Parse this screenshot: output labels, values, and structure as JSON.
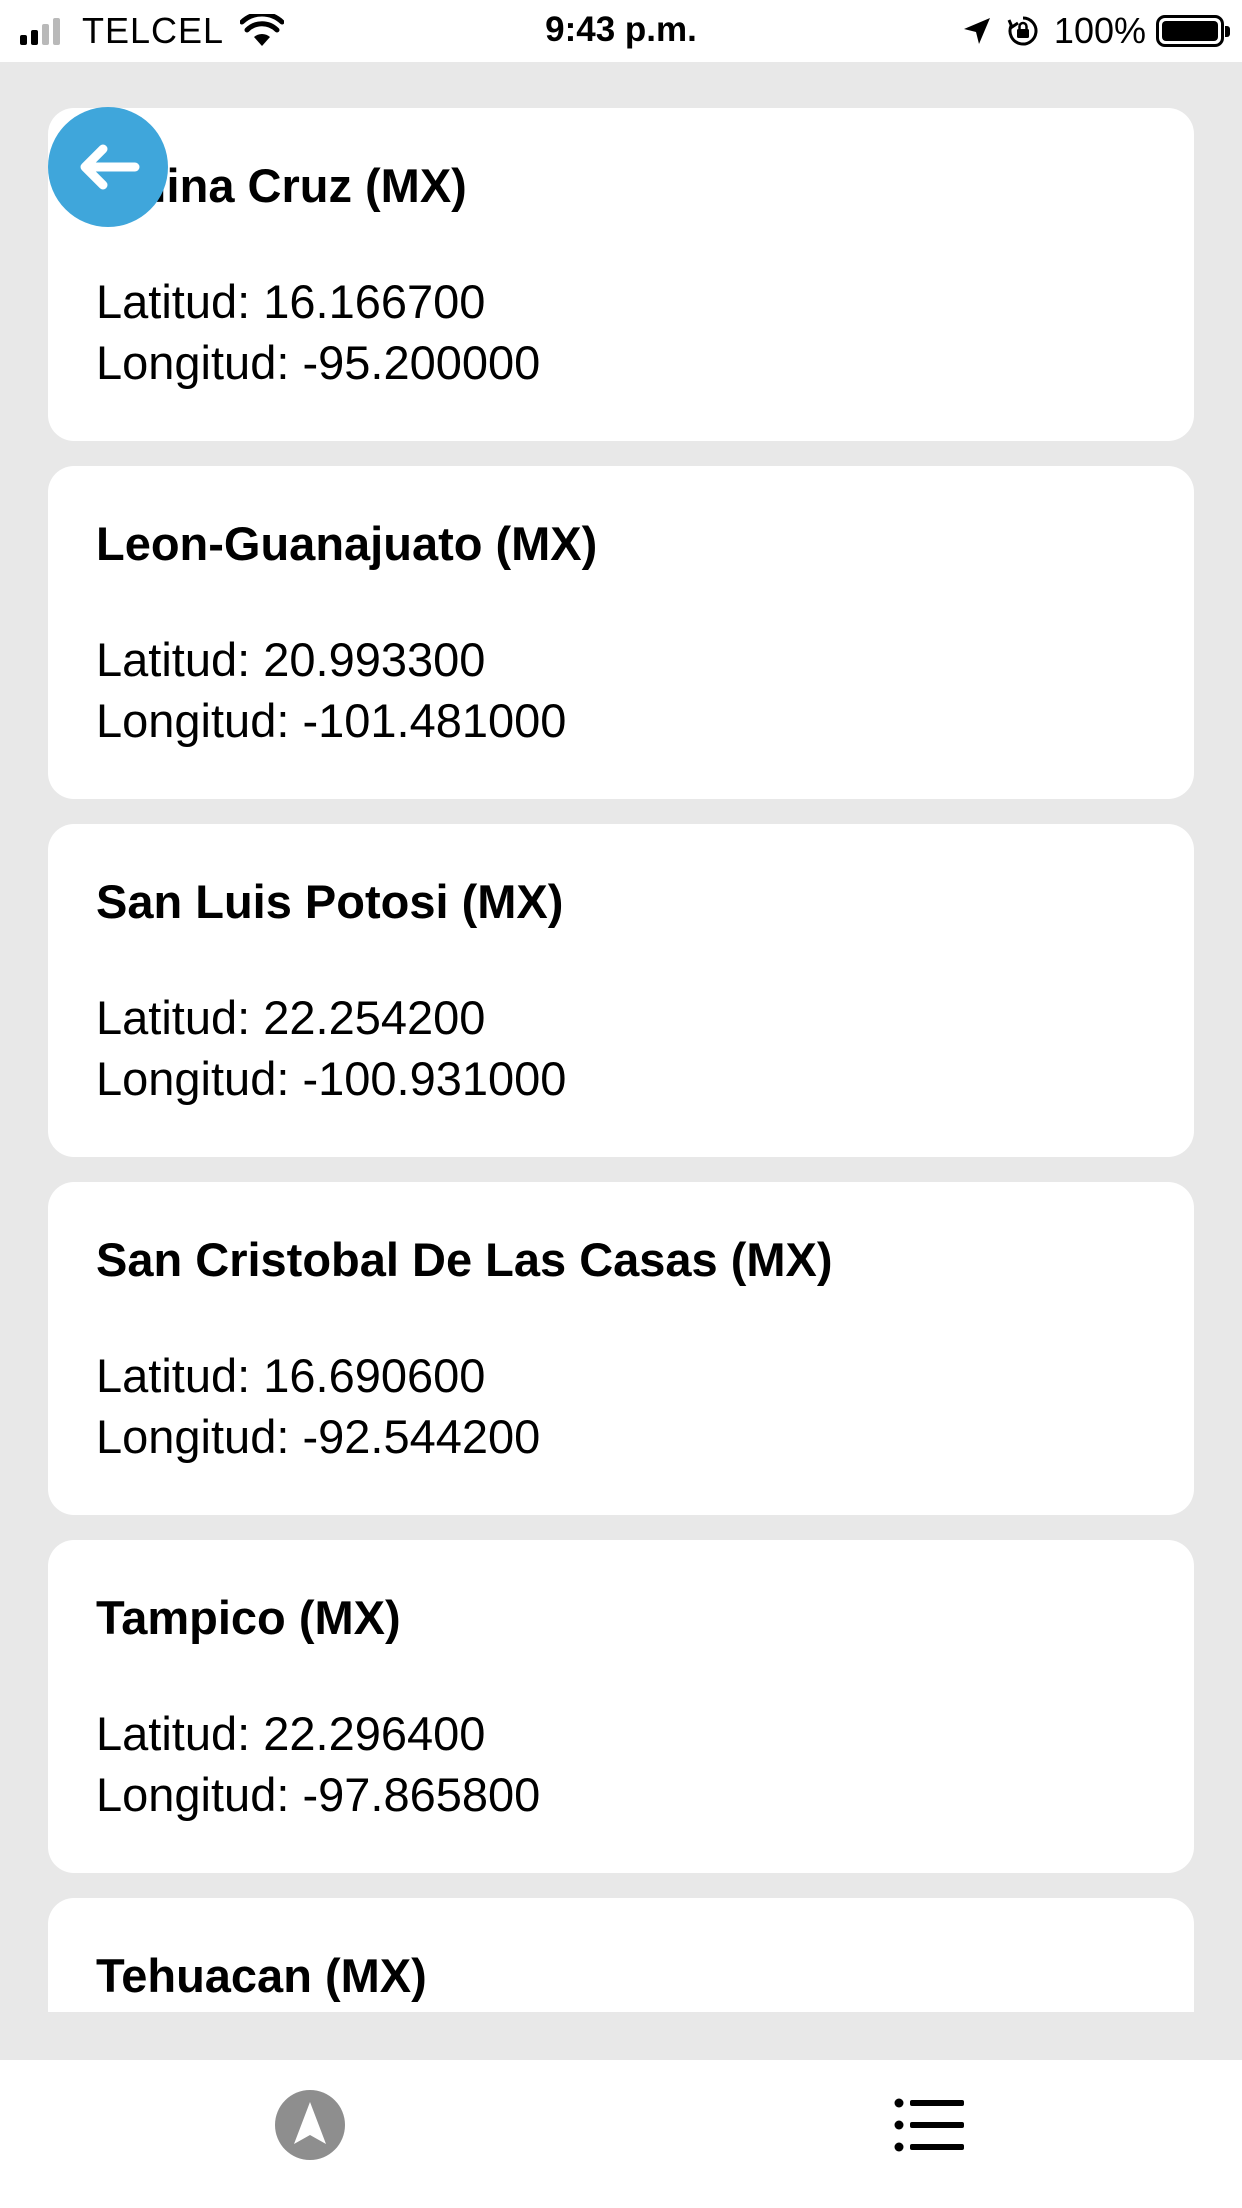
{
  "status_bar": {
    "carrier": "TELCEL",
    "time": "9:43 p.m.",
    "battery_percent": "100%",
    "signal_bars_filled": 2,
    "signal_bars_total": 4
  },
  "back_button": {
    "icon": "arrow-left-icon",
    "color": "#3fa6db"
  },
  "locations": [
    {
      "name": "Salina Cruz (MX)",
      "lat_label": "Latitud: 16.166700",
      "lon_label": "Longitud: -95.200000"
    },
    {
      "name": "Leon-Guanajuato (MX)",
      "lat_label": "Latitud: 20.993300",
      "lon_label": "Longitud: -101.481000"
    },
    {
      "name": "San Luis Potosi (MX)",
      "lat_label": "Latitud: 22.254200",
      "lon_label": "Longitud: -100.931000"
    },
    {
      "name": "San Cristobal De Las Casas (MX)",
      "lat_label": "Latitud: 16.690600",
      "lon_label": "Longitud: -92.544200"
    },
    {
      "name": "Tampico (MX)",
      "lat_label": "Latitud: 22.296400",
      "lon_label": "Longitud: -97.865800"
    },
    {
      "name": "Tehuacan (MX)",
      "lat_label": "",
      "lon_label": ""
    }
  ],
  "tab_bar": {
    "tabs": [
      {
        "icon": "navigation-arrow-icon",
        "color": "#8e8e8e"
      },
      {
        "icon": "list-icon",
        "color": "#000000"
      }
    ]
  }
}
